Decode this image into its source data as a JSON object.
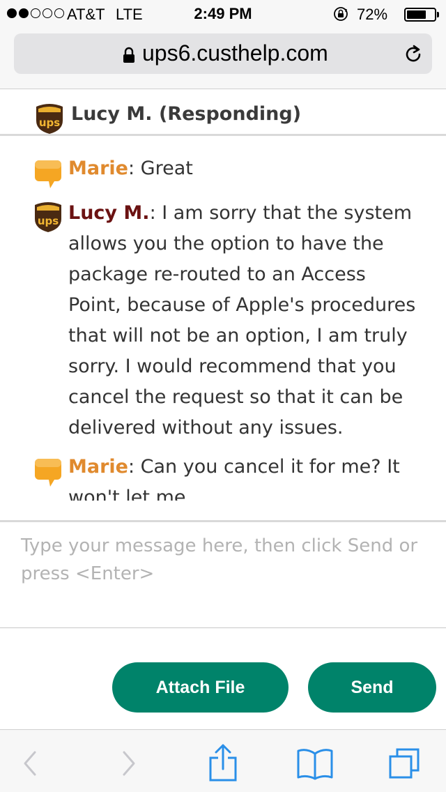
{
  "status_bar": {
    "signal_dots_filled": 2,
    "signal_dots_total": 5,
    "carrier": "AT&T",
    "network": "LTE",
    "time": "2:49 PM",
    "battery_percent_label": "72%",
    "battery_level": 0.72,
    "icons": [
      "rotation-lock-icon",
      "battery-icon"
    ]
  },
  "browser": {
    "url": "ups6.custhelp.com",
    "icons": [
      "lock-icon",
      "reload-icon"
    ]
  },
  "chat": {
    "agent_header": "Lucy M. (Responding)",
    "messages": [
      {
        "sender": "Marie",
        "sender_role": "customer",
        "icon": "chat-bubble-icon",
        "text": ": Great"
      },
      {
        "sender": "Lucy M.",
        "sender_role": "agent",
        "icon": "ups-logo-icon",
        "text": ": I am sorry that the system allows you the option to have the package re-routed to an Access Point, because of Apple's procedures that will not be an option, I am truly sorry. I would recommend that you cancel the request so that it can be delivered without any issues."
      },
      {
        "sender": "Marie",
        "sender_role": "customer",
        "icon": "chat-bubble-icon",
        "text": ": Can you cancel it for me? It won't let me"
      }
    ],
    "compose": {
      "placeholder": "Type your message here, then click Send or press <Enter>",
      "value": ""
    },
    "buttons": {
      "attach_label": "Attach File",
      "send_label": "Send"
    }
  },
  "toolbar": {
    "items": [
      "back-icon",
      "forward-icon",
      "share-icon",
      "bookmarks-icon",
      "tabs-icon"
    ]
  },
  "colors": {
    "button_green": "#00836a",
    "customer_name": "#e08a2e",
    "agent_name": "#6b1212",
    "ios_blue": "#2a8fe8",
    "ups_brown": "#4a2a12",
    "ups_gold": "#f2b632"
  }
}
